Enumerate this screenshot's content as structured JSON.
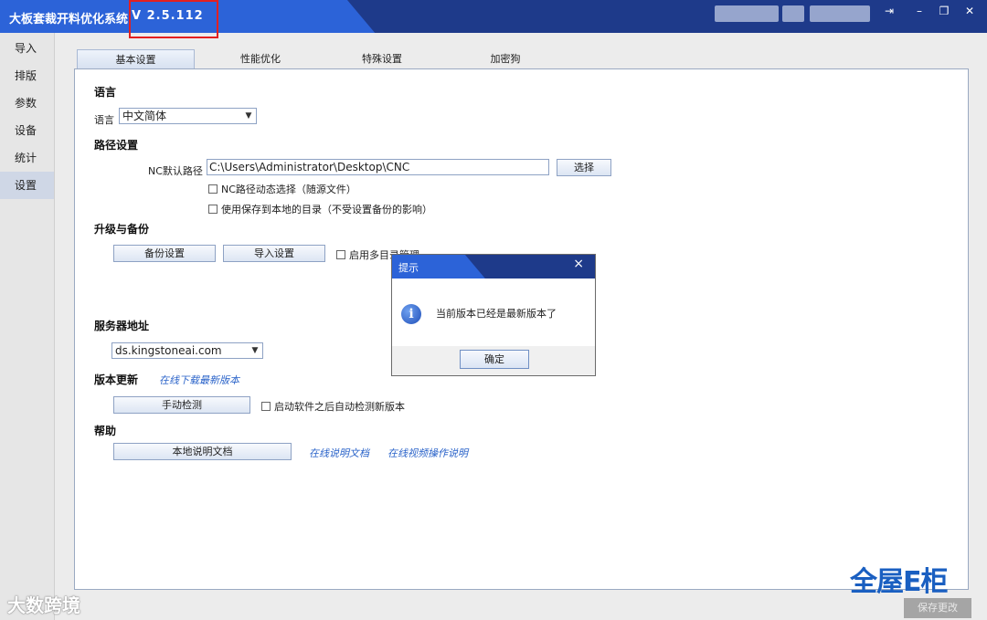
{
  "window": {
    "title": "大板套裁开料优化系统",
    "version": "V 2.5.112"
  },
  "sidebar": {
    "items": [
      {
        "label": "导入"
      },
      {
        "label": "排版"
      },
      {
        "label": "参数"
      },
      {
        "label": "设备"
      },
      {
        "label": "统计"
      },
      {
        "label": "设置",
        "active": true
      }
    ]
  },
  "tabs": [
    {
      "label": "基本设置",
      "active": true
    },
    {
      "label": "性能优化"
    },
    {
      "label": "特殊设置"
    },
    {
      "label": "加密狗"
    }
  ],
  "language": {
    "section": "语言",
    "label": "语言",
    "value": "中文简体"
  },
  "path": {
    "section": "路径设置",
    "nc_label": "NC默认路径",
    "nc_value": "C:\\Users\\Administrator\\Desktop\\CNC",
    "select_button": "选择",
    "dynamic_checkbox": "NC路径动态选择（随源文件）",
    "local_checkbox": "使用保存到本地的目录（不受设置备份的影响）"
  },
  "backup": {
    "section": "升级与备份",
    "backup_button": "备份设置",
    "import_button": "导入设置",
    "multi_dir_checkbox": "启用多目录管理"
  },
  "server": {
    "section": "服务器地址",
    "value": "ds.kingstoneai.com"
  },
  "update": {
    "section": "版本更新",
    "download_link": "在线下载最新版本",
    "check_button": "手动检测",
    "auto_checkbox": "启动软件之后自动检测新版本"
  },
  "help": {
    "section": "帮助",
    "local_doc_button": "本地说明文档",
    "online_doc_link": "在线说明文档",
    "video_link": "在线视频操作说明"
  },
  "dialog": {
    "title": "提示",
    "message": "当前版本已经是最新版本了",
    "ok_button": "确定"
  },
  "footer": {
    "save_button": "保存更改",
    "brand": "全屋E柜",
    "watermark": "大数跨境"
  }
}
